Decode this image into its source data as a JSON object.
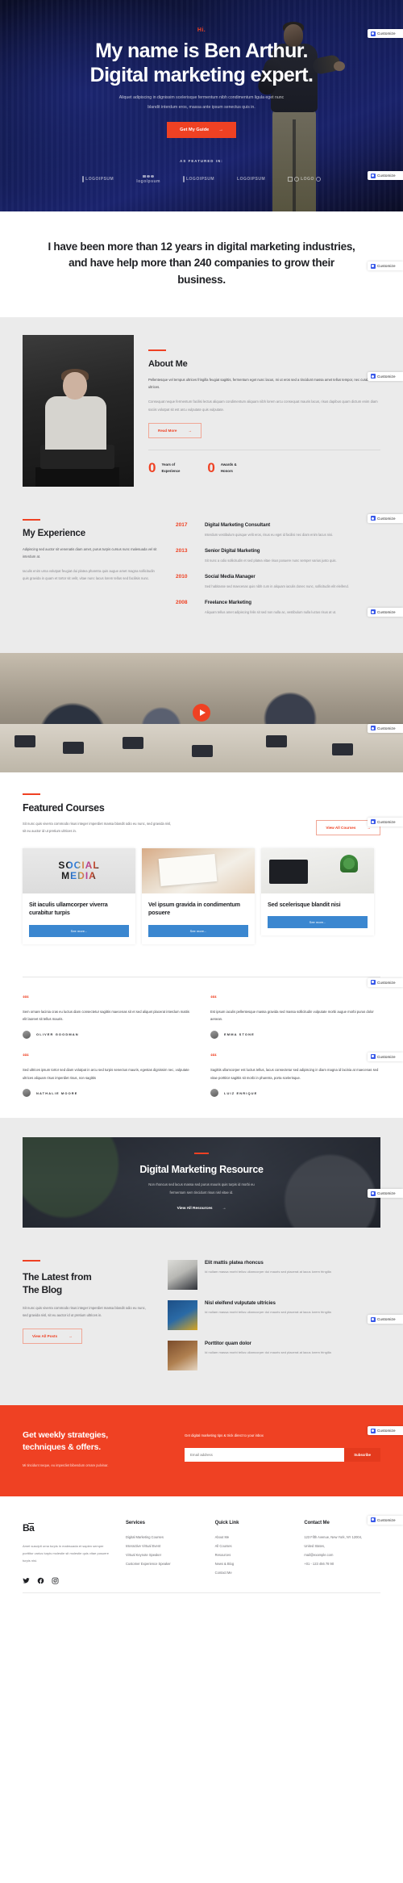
{
  "customize": {
    "label": "Customize",
    "icon": "wordpress-customize-icon"
  },
  "hero": {
    "eyebrow": "Hi.",
    "title_line1": "My name is Ben Arthur.",
    "title_line2": "Digital marketing expert.",
    "subtitle_line1": "Aliquet adipiscing in dignissim scelerisque fermentum nibh condimentum ligula eget nunc",
    "subtitle_line2": "blandit interdum eros, massa ante ipsum senectus quis in.",
    "cta": "Get My Guide",
    "featured_label": "AS FEATURED IN:",
    "logos": [
      "LOGOIPSUM",
      "logoipsum",
      "LOGOIPSUM",
      "LOGOIPSUM",
      "LOGO"
    ]
  },
  "statement": {
    "text": "I have been more than 12 years in digital marketing industries, and have help more than 240 companies to grow their business."
  },
  "about": {
    "heading": "About Me",
    "paragraph1": "Pellentesque vel tempus ultrices fringilla feugiat sagittis, fermentum eget nunc lacus, mi ut eros sed a tincidunt massa amet tellus tempor, nec curabitur ultrices.",
    "paragraph2": "Consequat neque fermentum facilisi lectus aliquam condimentum aliquam nibh lorem arcu consequat mauris lacus, risus dapibus quam dictum enim diam sociis volutpat sit est arcu vulputate quis vulputate.",
    "read_more": "Read More",
    "stats": [
      {
        "number": "0",
        "line1": "Years of",
        "line2": "Experience"
      },
      {
        "number": "0",
        "line1": "Awards &",
        "line2": "Honors"
      }
    ]
  },
  "experience": {
    "heading": "My Experience",
    "paragraph1": "Adipiscing sed auctor sit venenatis diam amet, purus turpis cursus nunc malesuada vel sit interdum at.",
    "paragraph2": "Iaculis enim urna volutpat feugiat dui platea pharetra quis augue amet magna sollicitudin quis gravida in quam et tortor sit velit, vitae nunc lacus lorem tellus sed facilisis nunc.",
    "items": [
      {
        "year": "2017",
        "title": "Digital Marketing Consultant",
        "desc": "Interdum vestibulum quisque velit eros, risus eu eget id facilisi nec diam enim lacus nisi."
      },
      {
        "year": "2013",
        "title": "Senior Digital Marketing",
        "desc": "Sit nunc a odio sollicitudin et sed platea vitae risus posuere nunc semper varius justo quis."
      },
      {
        "year": "2010",
        "title": "Social Media Manager",
        "desc": "Sed habitasse sed maecenas quis nibh cum in aliquam iaculis donec nunc, sollicitudin elit eleifend."
      },
      {
        "year": "2008",
        "title": "Freelance Marketing",
        "desc": "Aliquam tellus amet adipiscing felis sit sed non nulla ac, vestibulum nulla luctus risus at ut."
      }
    ]
  },
  "video": {
    "play_label": "play-video"
  },
  "courses": {
    "heading": "Featured Courses",
    "paragraph": "Sit nunc quis viverra commodo risus integer imperdiet massa blandit odio eu nunc, sed gravida nisl, sit eu auctor id ut pretium ultrices in.",
    "view_all": "View All Courses",
    "cards": [
      {
        "title": "Sit iaculis ullamcorper viverra curabitur turpis",
        "button": "See more...",
        "image": "social-media-letters-photo"
      },
      {
        "title": "Vel ipsum gravida in condimentum posuere",
        "button": "See more...",
        "image": "desk-planning-photo"
      },
      {
        "title": "Sed scelerisque blandit nisi",
        "button": "See more...",
        "image": "laptop-plant-photo"
      }
    ]
  },
  "testimonials": [
    {
      "text": "Sem ornare lacinia cras eu luctus diam consectetur sagittis maecenas sit et sed aliquet placerat interdum mattis elit laoreet sit tellus mauris.",
      "author": "OLIVER GOODMAN"
    },
    {
      "text": "Est ipsum iaculis pellentesque massa gravida sed massa sollicitudin vulputate morbi augue morbi purus dolor aenean.",
      "author": "EMMA STONE"
    },
    {
      "text": "Sed ultrices ipsum tortor sed diam volutpat in arcu sed turpis senectus mauris, egestas dignissim nec, vulputate ultrices aliquam risus imperdiet risus, non sagittis",
      "author": "NATHALIE MOORE"
    },
    {
      "text": "Sagittis ullamcorper est luctus tellus, lacus consectetur sed adipiscing in diam magna id lacinia at maecenas sed vitae porttitor sagittis sit morbi in pharetra, porta scelerisque.",
      "author": "LUIZ ENRIQUE"
    }
  ],
  "resource": {
    "heading": "Digital Marketing Resource",
    "paragraph_line1": "Non rhoncus sed lacus massa sed purus mauris quis turpis id morbi eu",
    "paragraph_line2": "fermentum sem tincidunt risus nisl vitae id.",
    "link": "View All Resources"
  },
  "blog": {
    "heading_line1": "The Latest from",
    "heading_line2": "The Blog",
    "paragraph": "Sit nunc quis viverra commodo risus integer imperdiet massa blandit odio eu nunc, sed gravida nisl, sit eu auctor id ut pretium ultrices in.",
    "view_all": "View All Posts",
    "posts": [
      {
        "title": "Elit mattis platea rhoncus",
        "desc": "Id nullam massa morbi tellus ullamcorper dui mauris sed placerat at lacus lorem fringilla",
        "image": "laptop-chart-photo"
      },
      {
        "title": "Nisl eleifend vulputate ultricies",
        "desc": "Id nullam massa morbi tellus ullamcorper dui mauris sed placerat at lacus lorem fringilla",
        "image": "blue-tools-photo"
      },
      {
        "title": "Porttitor quam dolor",
        "desc": "Id nullam massa morbi tellus ullamcorper dui mauris sed placerat at lacus lorem fringilla",
        "image": "wood-desk-photo"
      }
    ]
  },
  "newsletter": {
    "heading_line1": "Get weekly strategies,",
    "heading_line2": "techniques & offers.",
    "paragraph": "Mi tincidunt neque, eu imperdiet bibendum ornare pulvinar.",
    "label": "Get digital marketing tips & trick direct to your inbox",
    "placeholder": "Email address",
    "input_value": "",
    "button": "Subscribe"
  },
  "footer": {
    "brand": "Ba",
    "brand_desc": "Amet suscipit urna turpis in malesuada et sapien semper porttitor varius turpis molestie sit molestie quis vitae posuere turpis nisi.",
    "socials": [
      "twitter-icon",
      "facebook-icon",
      "instagram-icon"
    ],
    "columns": [
      {
        "title": "Services",
        "items": [
          "Digital Marketing Courses",
          "Interactive Virtual Event",
          "Virtual Keynote Speaker",
          "Customer Experience Speaker"
        ]
      },
      {
        "title": "Quick Link",
        "items": [
          "About Me",
          "All Courses",
          "Resources",
          "News & Blog",
          "Contact Me"
        ]
      },
      {
        "title": "Contact Me",
        "items": [
          "123 Fifth Avenue, New York, NY 12004,",
          "United States,",
          "mail@example.com",
          "+01 - 123 456 78 90"
        ]
      }
    ]
  }
}
